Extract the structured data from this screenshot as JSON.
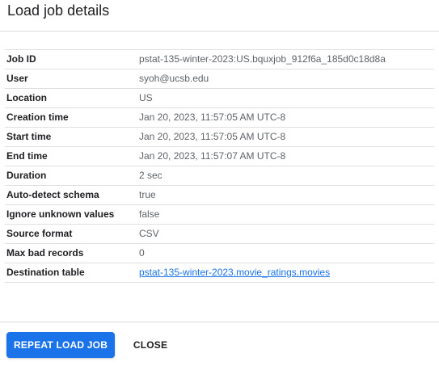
{
  "dialog": {
    "title": "Load job details"
  },
  "details": [
    {
      "label": "Job ID",
      "value": "pstat-135-winter-2023:US.bquxjob_912f6a_185d0c18d8a"
    },
    {
      "label": "User",
      "value": "syoh@ucsb.edu"
    },
    {
      "label": "Location",
      "value": "US"
    },
    {
      "label": "Creation time",
      "value": "Jan 20, 2023, 11:57:05 AM UTC-8"
    },
    {
      "label": "Start time",
      "value": "Jan 20, 2023, 11:57:05 AM UTC-8"
    },
    {
      "label": "End time",
      "value": "Jan 20, 2023, 11:57:07 AM UTC-8"
    },
    {
      "label": "Duration",
      "value": "2 sec"
    },
    {
      "label": "Auto-detect schema",
      "value": "true"
    },
    {
      "label": "Ignore unknown values",
      "value": "false"
    },
    {
      "label": "Source format",
      "value": "CSV"
    },
    {
      "label": "Max bad records",
      "value": "0"
    },
    {
      "label": "Destination table",
      "value": "pstat-135-winter-2023.movie_ratings.movies"
    }
  ],
  "footer": {
    "repeat_label": "REPEAT LOAD JOB",
    "close_label": "CLOSE"
  },
  "colors": {
    "primary": "#1a73e8",
    "label_text": "#202124",
    "value_text": "#5f6368",
    "link": "#1a73e8"
  }
}
